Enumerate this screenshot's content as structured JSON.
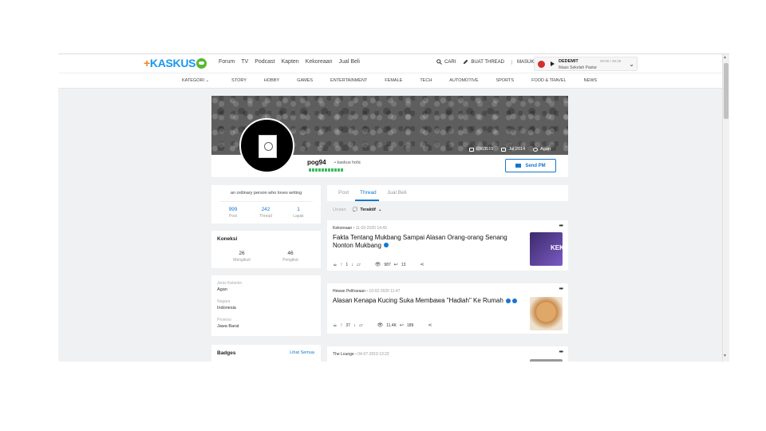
{
  "header": {
    "logo_text": "KASKUS",
    "nav": [
      "Forum",
      "TV",
      "Podcast",
      "Kapten",
      "Kekoreaan",
      "Jual Beli"
    ],
    "search_label": "CARI",
    "create_thread_label": "BUAT THREAD",
    "login_label": "MASUK",
    "player": {
      "title": "DEDEMIT",
      "subtitle": "Iklass Sekolah Pastur",
      "time": "00:00 / 26:29"
    }
  },
  "category_bar": {
    "kategori_label": "KATEGORI",
    "items": [
      "STORY",
      "HOBBY",
      "GAMES",
      "ENTERTAINMENT",
      "FEMALE",
      "TECH",
      "AUTOMOTIVE",
      "SPORTS",
      "FOOD & TRAVEL",
      "NEWS"
    ]
  },
  "profile": {
    "username": "pog94",
    "rank": "kaskus holic",
    "reputation_bars": 11,
    "send_pm_label": "Send PM",
    "cover_stats": {
      "user_id": "6963519",
      "joined": "Jul 2014",
      "role": "Agan"
    },
    "bio": "an ordinary person who loves writing",
    "stats": [
      {
        "value": "999",
        "label": "Post"
      },
      {
        "value": "242",
        "label": "Thread"
      },
      {
        "value": "1",
        "label": "Lapak"
      }
    ],
    "koneksi": {
      "title": "Koneksi",
      "following": {
        "value": "26",
        "label": "Mengikuti"
      },
      "followers": {
        "value": "46",
        "label": "Pengikut"
      }
    },
    "details": [
      {
        "label": "Jenis Kelamin",
        "value": "Agan"
      },
      {
        "label": "Negara",
        "value": "Indonesia"
      },
      {
        "label": "Provinsi",
        "value": "Jawa Barat"
      }
    ],
    "badges": {
      "title": "Badges",
      "link": "Lihat Semua"
    }
  },
  "tabs": {
    "items": [
      "Post",
      "Thread",
      "Jual Beli"
    ],
    "active": "Thread"
  },
  "sort": {
    "label": "Urutan",
    "value": "Teraktif"
  },
  "threads": [
    {
      "category": "Kekoreaan",
      "date": "11-02-2020 14:43",
      "title": "Fakta Tentang Mukbang Sampai Alasan Orang-orang Senang Nonton Mukbang",
      "votes": "1",
      "views": "987",
      "replies": "13",
      "thumb_color": "#5a3d8a",
      "thumb_text": "KEK"
    },
    {
      "category": "Hewan Peliharaan",
      "date": "10-02-2020 11:47",
      "title": "Alasan Kenapa Kucing Suka Membawa \"Hadiah\" Ke Rumah",
      "votes": "37",
      "views": "11.4K",
      "replies": "189",
      "thumb_color": "#c98a4b",
      "thumb_text": ""
    },
    {
      "category": "The Lounge",
      "date": "04-07-2019 13:22",
      "title": "",
      "votes": "",
      "views": "",
      "replies": "",
      "thumb_color": "#8a8a8a",
      "thumb_text": ""
    }
  ]
}
